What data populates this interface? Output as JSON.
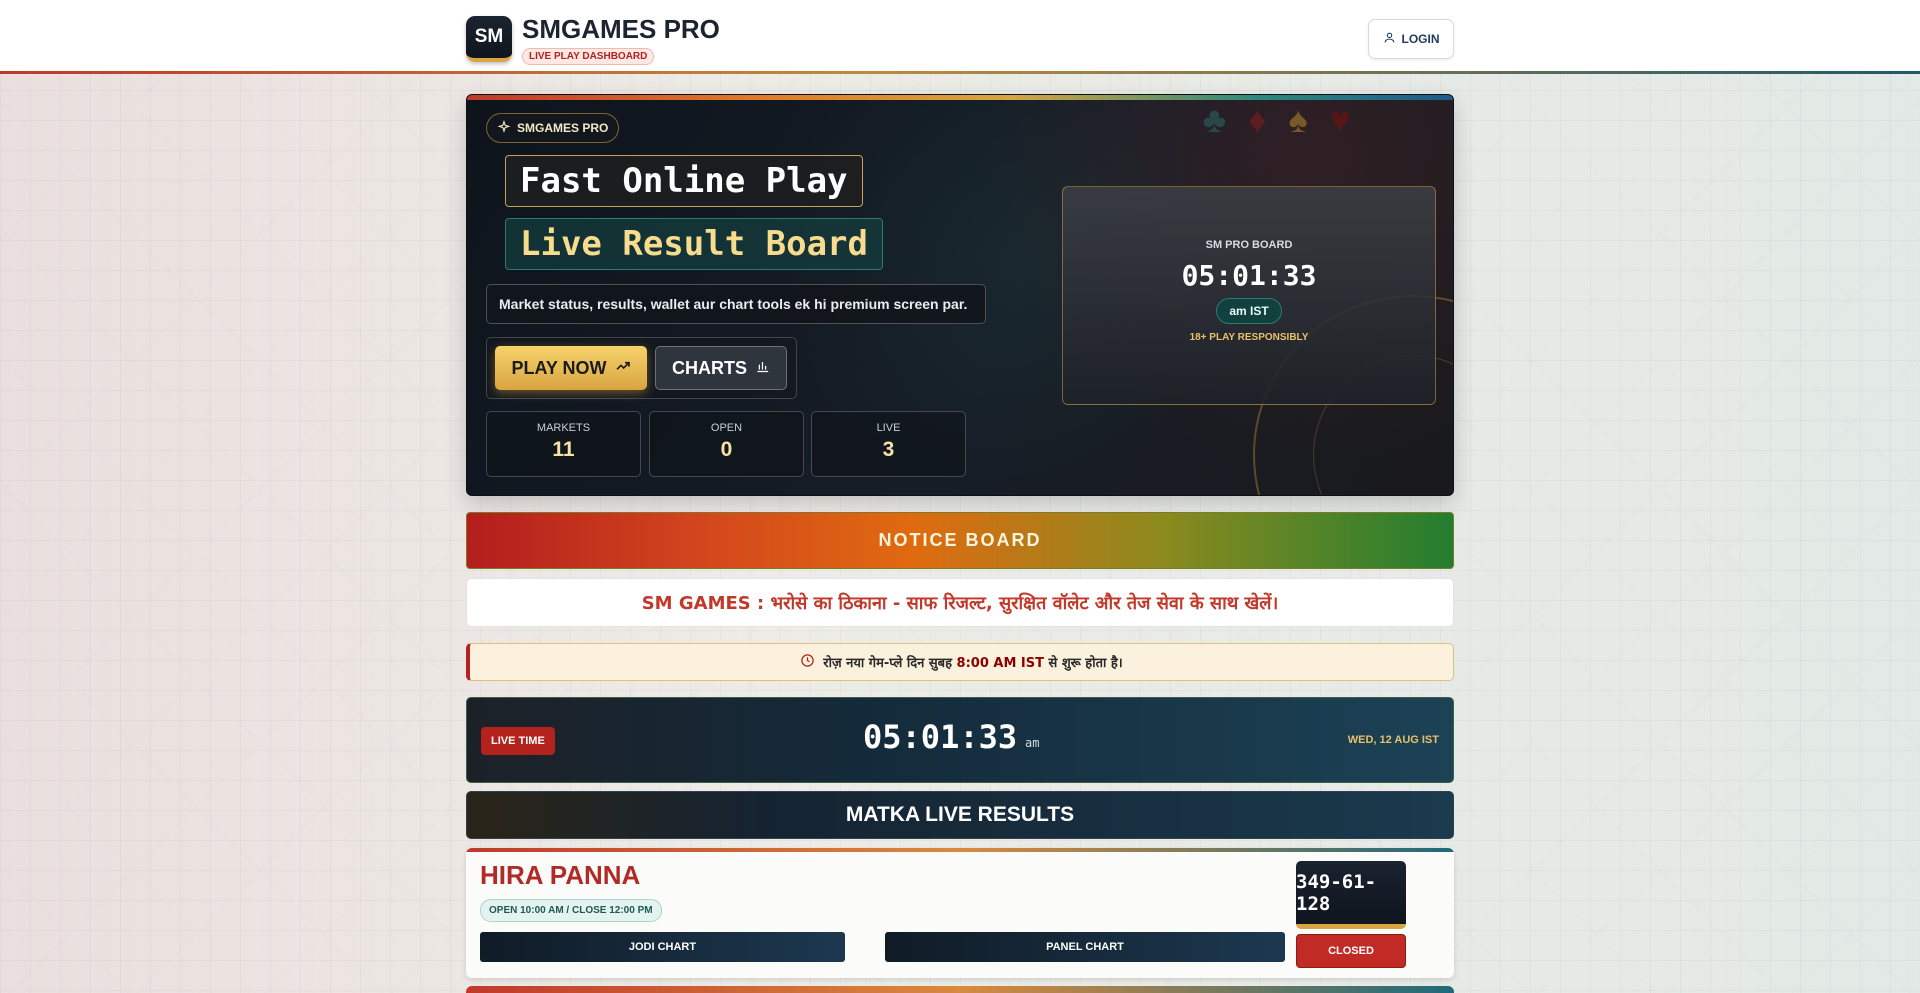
{
  "header": {
    "logo_text": "SM",
    "title": "SMGAMES PRO",
    "subtitle": "LIVE PLAY DASHBOARD",
    "login_label": "LOGIN"
  },
  "hero": {
    "badge": "SMGAMES PRO",
    "headline_1": "Fast Online Play",
    "headline_2": "Live Result Board",
    "description": "Market status, results, wallet aur chart tools ek hi premium screen par.",
    "play_label": "PLAY NOW",
    "charts_label": "CHARTS",
    "stats": [
      {
        "label": "MARKETS",
        "value": "11"
      },
      {
        "label": "OPEN",
        "value": "0"
      },
      {
        "label": "LIVE",
        "value": "3"
      }
    ],
    "board": {
      "title": "SM PRO BOARD",
      "time": "05:01:33",
      "zone": "am IST",
      "warning": "18+ PLAY RESPONSIBLY"
    }
  },
  "notice": {
    "title": "NOTICE BOARD",
    "slogan": "SM GAMES : भरोसे का ठिकाना - साफ रिजल्ट, सुरक्षित वॉलेट और तेज सेवा के साथ खेलें।",
    "timing_before": "रोज़ नया गेम-प्ले दिन सुबह",
    "timing_highlight": "8:00 AM IST",
    "timing_after": "से शुरू होता है।"
  },
  "live": {
    "tag": "LIVE TIME",
    "clock": "05:01:33",
    "ampm": "am",
    "date": "WED, 12 AUG IST"
  },
  "results": {
    "heading": "MATKA LIVE RESULTS",
    "markets": [
      {
        "name": "HIRA PANNA",
        "timing": "OPEN 10:00 AM / CLOSE 12:00 PM",
        "jodi_label": "JODI CHART",
        "panel_label": "PANEL CHART",
        "result": "349-61-128",
        "status": "CLOSED"
      }
    ]
  },
  "colors": {
    "accent_gold": "#d9a441",
    "accent_red": "#c0392b",
    "dark_navy": "#0f151d",
    "teal": "#1f5a6b"
  }
}
